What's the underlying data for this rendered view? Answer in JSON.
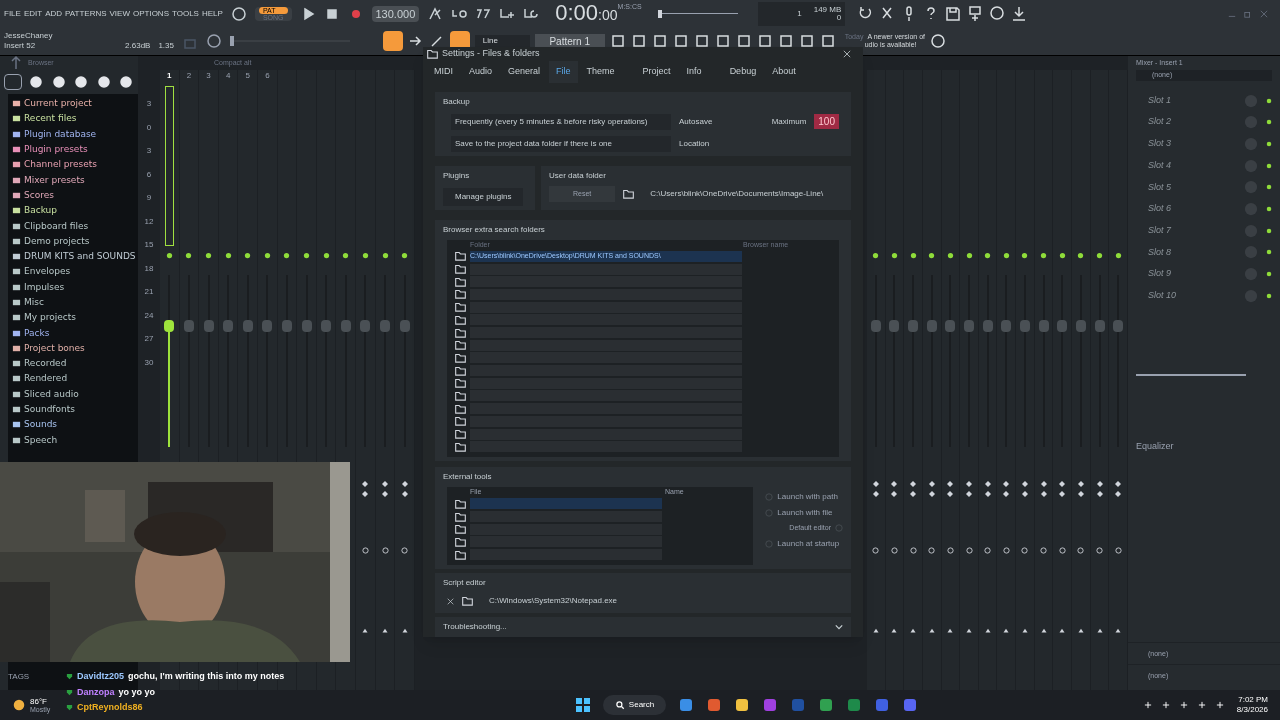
{
  "menu": [
    "FILE",
    "EDIT",
    "ADD",
    "PATTERNS",
    "VIEW",
    "OPTIONS",
    "TOOLS",
    "HELP"
  ],
  "modes": [
    {
      "label": "PAT",
      "selected": true
    },
    {
      "label": "SONG",
      "selected": false
    }
  ],
  "tempo": "130.000",
  "clock": {
    "time": "0:00",
    "cs": ":00",
    "unit": "M:S:CS"
  },
  "monitor": {
    "cpu": "1",
    "memory": "149 MB",
    "polyphony": "0"
  },
  "hint": {
    "user": "JesseChaney",
    "target": "Insert 52",
    "gain": "2.63dB",
    "value": "1.35"
  },
  "song_position": {
    "level": 0
  },
  "master_pitch": {
    "level": 0
  },
  "snap": "Line",
  "pattern": "Pattern 1",
  "news": {
    "date": "Today",
    "line1": "A newer version of",
    "line2": "udio is available!"
  },
  "browser": {
    "title": "Browser",
    "items": [
      {
        "label": "Current project",
        "color": "#e8b0a8"
      },
      {
        "label": "Recent files",
        "color": "#c8e0a0"
      },
      {
        "label": "Plugin database",
        "color": "#a0b4f0"
      },
      {
        "label": "Plugin presets",
        "color": "#e890b8"
      },
      {
        "label": "Channel presets",
        "color": "#e8a0b0"
      },
      {
        "label": "Mixer presets",
        "color": "#e0a8b8"
      },
      {
        "label": "Scores",
        "color": "#e0a8b8"
      },
      {
        "label": "Backup",
        "color": "#c8e0a0"
      },
      {
        "label": "Clipboard files",
        "color": "#b8c8c8"
      },
      {
        "label": "Demo projects",
        "color": "#b8c8c8"
      },
      {
        "label": "DRUM KITS  and SOUNDS",
        "color": "#c0ccd4"
      },
      {
        "label": "Envelopes",
        "color": "#b8c8c8"
      },
      {
        "label": "Impulses",
        "color": "#b8c8c8"
      },
      {
        "label": "Misc",
        "color": "#b8c8c8"
      },
      {
        "label": "My projects",
        "color": "#b8c8c8"
      },
      {
        "label": "Packs",
        "color": "#a0b4f0"
      },
      {
        "label": "Project bones",
        "color": "#e0b0a8"
      },
      {
        "label": "Recorded",
        "color": "#b8c8c8"
      },
      {
        "label": "Rendered",
        "color": "#b8c8c8"
      },
      {
        "label": "Sliced audio",
        "color": "#b8c8c8"
      },
      {
        "label": "Soundfonts",
        "color": "#b8c8c8"
      },
      {
        "label": "Sounds",
        "color": "#a8c4f0"
      },
      {
        "label": "Speech",
        "color": "#b8c8c8"
      }
    ]
  },
  "mixer": {
    "view": "Compact alt",
    "scale": [
      "3",
      "0",
      "3",
      "6",
      "9",
      "12",
      "15",
      "18",
      "21",
      "24",
      "27",
      "30"
    ],
    "tracks": [
      {
        "label": "1",
        "selected": true
      },
      {
        "label": "2",
        "selected": false
      },
      {
        "label": "3",
        "selected": false
      },
      {
        "label": "4",
        "selected": false
      },
      {
        "label": "5",
        "selected": false
      },
      {
        "label": "6",
        "selected": false
      }
    ]
  },
  "settings": {
    "title": "Settings - Files & folders",
    "tabs": [
      {
        "label": "MIDI",
        "selected": false
      },
      {
        "label": "Audio",
        "selected": false
      },
      {
        "label": "General",
        "selected": false
      },
      {
        "label": "File",
        "selected": true
      },
      {
        "label": "Theme",
        "selected": false
      },
      {
        "label": "Project",
        "selected": false
      },
      {
        "label": "Info",
        "selected": false
      },
      {
        "label": "Debug",
        "selected": false
      },
      {
        "label": "About",
        "selected": false
      }
    ],
    "backup": {
      "heading": "Backup",
      "rows": [
        {
          "value": "Frequently (every 5 minutes & before risky operations)",
          "label": "Autosave"
        },
        {
          "value": "Save to the project data folder if there is one",
          "label": "Location"
        }
      ],
      "maximum_label": "Maximum",
      "maximum": "100"
    },
    "plugins": {
      "heading": "Plugins",
      "button": "Manage plugins"
    },
    "user_data": {
      "heading": "User data folder",
      "reset": "Reset",
      "path": "C:\\Users\\blink\\OneDrive\\Documents\\Image-Line\\"
    },
    "extra_folders": {
      "heading": "Browser extra search folders",
      "columns": [
        "Folder",
        "Browser name"
      ],
      "rows": [
        {
          "folder": "C:\\Users\\blink\\OneDrive\\Desktop\\DRUM KITS  and SOUNDS\\",
          "selected": true
        },
        {
          "selected": false
        },
        {
          "selected": false
        },
        {
          "selected": false
        },
        {
          "selected": false
        },
        {
          "selected": false
        },
        {
          "selected": false
        },
        {
          "selected": false
        },
        {
          "selected": false
        },
        {
          "selected": false
        },
        {
          "selected": false
        },
        {
          "selected": false
        },
        {
          "selected": false
        },
        {
          "selected": false
        },
        {
          "selected": false
        },
        {
          "selected": false
        }
      ]
    },
    "external_tools": {
      "heading": "External tools",
      "columns": [
        "File",
        "Name"
      ],
      "rows": [
        {
          "selected": true
        },
        {
          "selected": false
        },
        {
          "selected": false
        },
        {
          "selected": false
        },
        {
          "selected": false
        }
      ],
      "options": [
        {
          "label": "Launch with path",
          "checked": false
        },
        {
          "label": "Launch with file",
          "checked": false
        },
        {
          "label": "Default editor",
          "checked": false
        },
        {
          "label": "Launch at startup",
          "checked": false
        }
      ]
    },
    "script_editor": {
      "heading": "Script editor",
      "path": "C:\\Windows\\System32\\Notepad.exe"
    },
    "troubleshooting": {
      "label": "Troubleshooting...",
      "expanded": false
    }
  },
  "insert_panel": {
    "title": "Mixer - Insert 1",
    "input": "(none)",
    "slots": [
      "Slot 1",
      "Slot 2",
      "Slot 3",
      "Slot 4",
      "Slot 5",
      "Slot 6",
      "Slot 7",
      "Slot 8",
      "Slot 9",
      "Slot 10"
    ],
    "equalizer": "Equalizer",
    "outputs": [
      "(none)",
      "(none)"
    ]
  },
  "webcam": {
    "kind": "picture"
  },
  "chat": {
    "tags": "TAGS",
    "messages": [
      {
        "user": "Davidtz205",
        "color": "#9cc8ff",
        "text": "gochu, I'm writing this into my notes"
      },
      {
        "user": "Danzopa",
        "color": "#c080ff",
        "text": "yo yo yo"
      },
      {
        "user": "CptReynolds86",
        "color": "#f0b020"
      }
    ]
  },
  "taskbar": {
    "temp": "86°F",
    "weather": "Mostly",
    "search": "Search",
    "time": "7:02 PM",
    "date": "8/3/2026"
  }
}
